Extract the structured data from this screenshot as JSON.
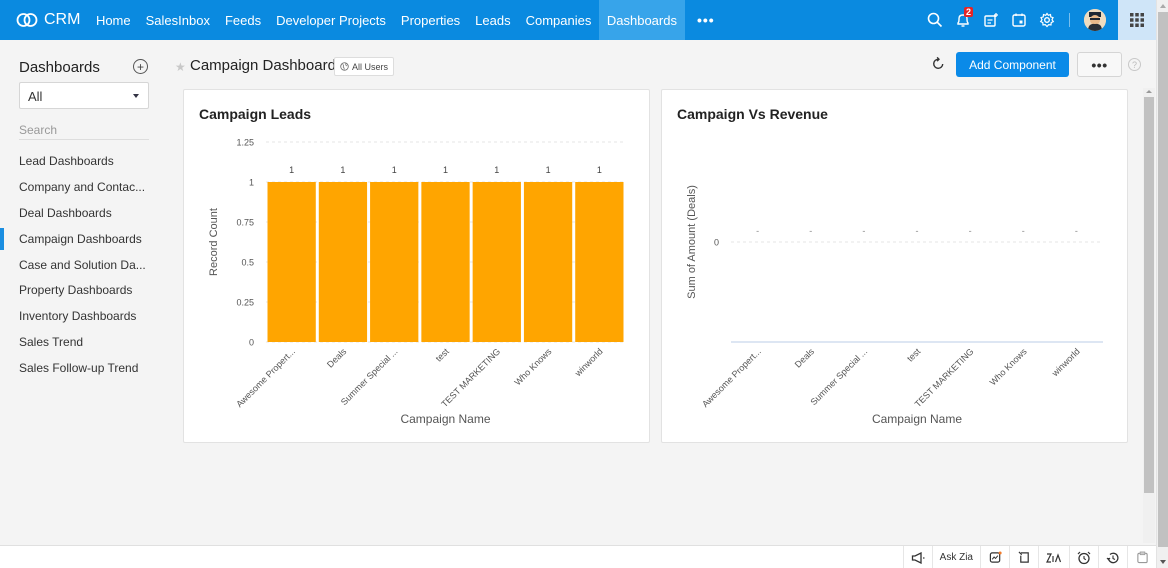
{
  "topbar": {
    "brand": "CRM",
    "nav": [
      {
        "label": "Home",
        "active": false
      },
      {
        "label": "SalesInbox",
        "active": false
      },
      {
        "label": "Feeds",
        "active": false
      },
      {
        "label": "Developer Projects",
        "active": false
      },
      {
        "label": "Properties",
        "active": false
      },
      {
        "label": "Leads",
        "active": false
      },
      {
        "label": "Companies",
        "active": false
      },
      {
        "label": "Dashboards",
        "active": true
      }
    ],
    "more_label": "•••",
    "notification_count": "2",
    "icons": [
      "search-icon",
      "bell-icon",
      "add-note-icon",
      "calendar-icon",
      "settings-icon",
      "avatar",
      "apps-grid-icon"
    ]
  },
  "sidebar": {
    "title": "Dashboards",
    "add_label": "+",
    "filter_value": "All",
    "search_placeholder": "Search",
    "items": [
      {
        "label": "Lead Dashboards",
        "active": false
      },
      {
        "label": "Company and Contac...",
        "active": false
      },
      {
        "label": "Deal Dashboards",
        "active": false
      },
      {
        "label": "Campaign Dashboards",
        "active": true
      },
      {
        "label": "Case and Solution Da...",
        "active": false
      },
      {
        "label": "Property Dashboards",
        "active": false
      },
      {
        "label": "Inventory Dashboards",
        "active": false
      },
      {
        "label": "Sales Trend",
        "active": false
      },
      {
        "label": "Sales Follow-up Trend",
        "active": false
      }
    ]
  },
  "header": {
    "title": "Campaign Dashboards",
    "visibility": "All Users",
    "add_component_label": "Add Component",
    "more_label": "•••",
    "help_label": "?"
  },
  "bottombar": {
    "items": [
      "megaphone-icon",
      "Ask Zia",
      "chart-icon",
      "notes-icon",
      "zia-icon",
      "alarm-icon",
      "history-icon",
      "clipboard-icon"
    ],
    "ask_zia_label": "Ask Zia"
  },
  "colors": {
    "brand": "#0a8ae0",
    "bar": "#ffa500",
    "accent_button": "#0a8ae8"
  },
  "chart_data": [
    {
      "type": "bar",
      "title": "Campaign Leads",
      "xlabel": "Campaign Name",
      "ylabel": "Record Count",
      "categories": [
        "Awesome Propert...",
        "Deals",
        "Summer Special ...",
        "test",
        "TEST MARKETING",
        "Who Knows",
        "winworld"
      ],
      "values": [
        1,
        1,
        1,
        1,
        1,
        1,
        1
      ],
      "data_labels": [
        "1",
        "1",
        "1",
        "1",
        "1",
        "1",
        "1"
      ],
      "ylim": [
        0,
        1.25
      ],
      "yticks": [
        0,
        0.25,
        0.5,
        0.75,
        1,
        1.25
      ],
      "ytick_labels": [
        "0",
        "0.25",
        "0.5",
        "0.75",
        "1",
        "1.25"
      ],
      "grid": true,
      "legend": "none"
    },
    {
      "type": "bar",
      "title": "Campaign Vs Revenue",
      "xlabel": "Campaign Name",
      "ylabel": "Sum of Amount (Deals)",
      "categories": [
        "Awesome Propert...",
        "Deals",
        "Summer Special ...",
        "test",
        "TEST MARKETING",
        "Who Knows",
        "winworld"
      ],
      "values": [
        null,
        null,
        null,
        null,
        null,
        null,
        null
      ],
      "data_labels": [
        "-",
        "-",
        "-",
        "-",
        "-",
        "-",
        "-"
      ],
      "yticks": [
        0
      ],
      "ytick_labels": [
        "0"
      ],
      "grid": true,
      "legend": "none"
    }
  ]
}
